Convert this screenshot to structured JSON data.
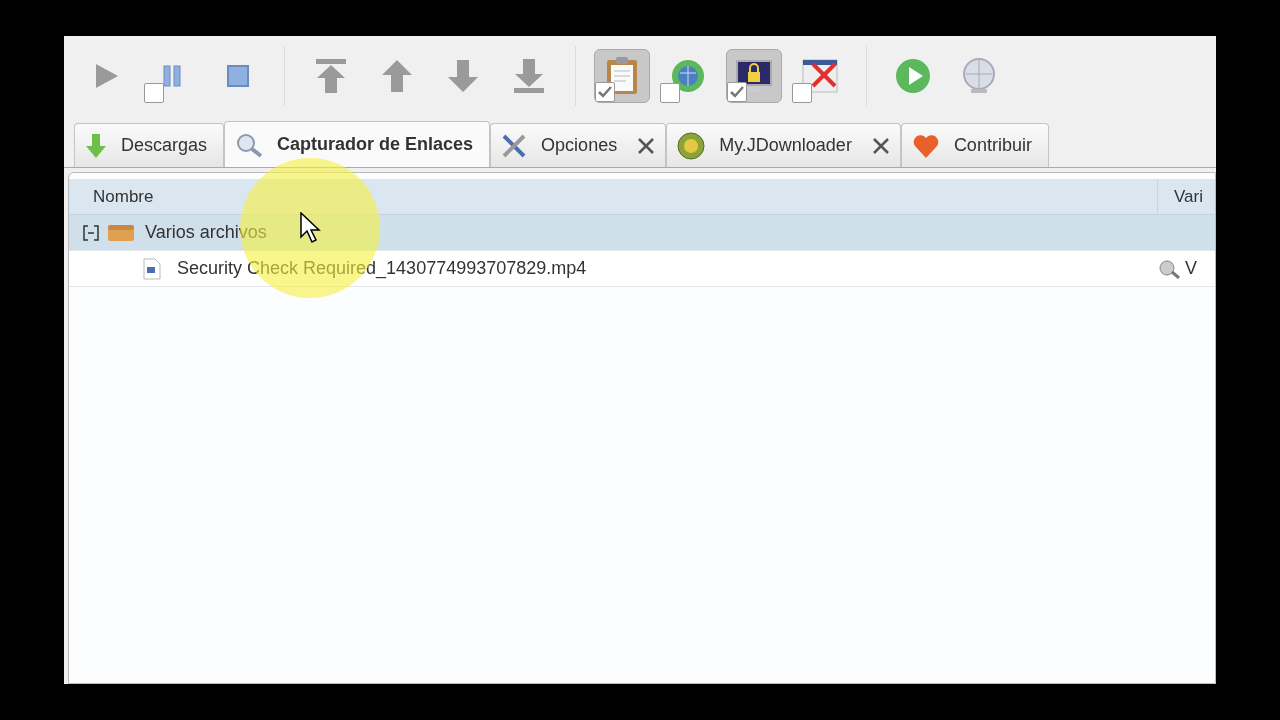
{
  "toolbar": {
    "groups": [
      [
        {
          "kind": "button"
        },
        {
          "kind": "toggle",
          "pressed": false,
          "checked": false
        },
        {
          "kind": "button"
        }
      ],
      [
        {
          "kind": "button"
        },
        {
          "kind": "button"
        },
        {
          "kind": "button"
        },
        {
          "kind": "button"
        }
      ],
      [
        {
          "kind": "toggle",
          "pressed": true,
          "checked": true
        },
        {
          "kind": "toggle",
          "pressed": false,
          "checked": false
        },
        {
          "kind": "toggle",
          "pressed": true,
          "checked": true
        },
        {
          "kind": "toggle",
          "pressed": false,
          "checked": false
        }
      ],
      [
        {
          "kind": "button"
        },
        {
          "kind": "button"
        }
      ]
    ]
  },
  "tabs": [
    {
      "label": "Descargas",
      "selected": false,
      "closable": false
    },
    {
      "label": "Capturador de Enlaces",
      "selected": true,
      "closable": false
    },
    {
      "label": "Opciones",
      "selected": false,
      "closable": true
    },
    {
      "label": "My.JDownloader",
      "selected": false,
      "closable": true
    },
    {
      "label": "Contribuir",
      "selected": false,
      "closable": false
    }
  ],
  "table": {
    "columns": [
      "Nombre",
      "Vari"
    ],
    "rows": [
      {
        "kind": "package",
        "name": "Varios archivos",
        "expanded": true,
        "selected": true,
        "children": [
          {
            "kind": "file",
            "name": "Security Check Required_1430774993707829.mp4",
            "selected": false,
            "column_2": "V"
          }
        ]
      }
    ]
  }
}
